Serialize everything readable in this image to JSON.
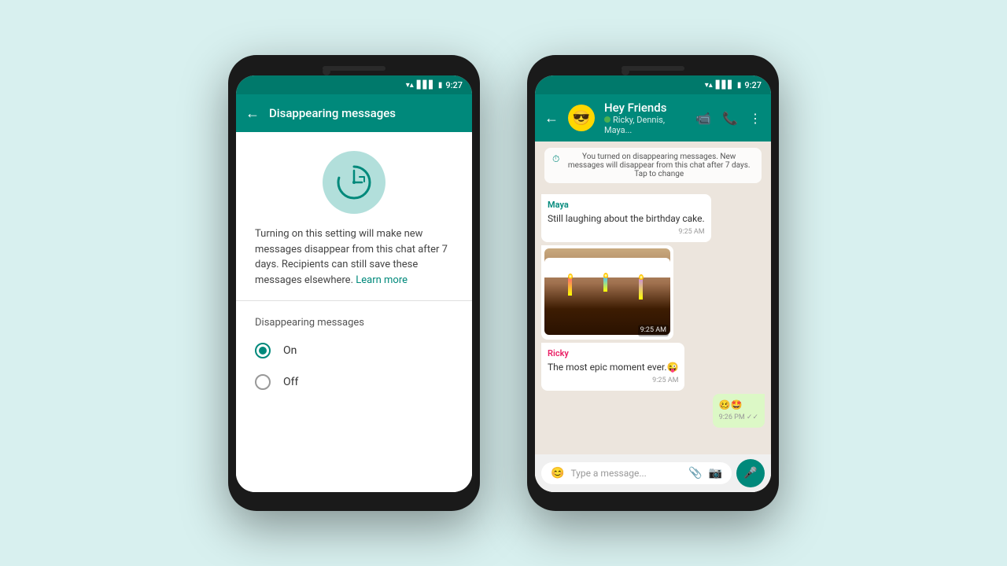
{
  "background_color": "#d8f0ef",
  "phone1": {
    "status_bar": {
      "time": "9:27",
      "bg_color": "#00796b"
    },
    "toolbar": {
      "title": "Disappearing messages",
      "back_arrow": "←"
    },
    "description": "Turning on this setting will make new messages disappear from this chat after 7 days. Recipients can still save these messages elsewhere.",
    "learn_more": "Learn more",
    "section_title": "Disappearing messages",
    "radio_on_label": "On",
    "radio_off_label": "Off",
    "on_selected": true
  },
  "phone2": {
    "status_bar": {
      "time": "9:27",
      "bg_color": "#00796b"
    },
    "toolbar": {
      "back_arrow": "←",
      "group_name": "Hey Friends",
      "members": "Ricky, Dennis, Maya...",
      "avatar_emoji": "😎"
    },
    "system_message": "You turned on disappearing messages. New messages will disappear from this chat after 7 days. Tap to change",
    "messages": [
      {
        "sender": "Maya",
        "sender_color": "maya",
        "text": "Still laughing about the birthday cake.",
        "time": "9:25 AM",
        "type": "incoming"
      },
      {
        "sender": "",
        "type": "image",
        "time": "9:25 AM"
      },
      {
        "sender": "Ricky",
        "sender_color": "ricky",
        "text": "The most epic moment ever.😜",
        "time": "9:25 AM",
        "type": "incoming"
      },
      {
        "sender": "",
        "text": "🥴🤩",
        "time": "9:26 PM ✓✓",
        "type": "outgoing"
      }
    ],
    "input_placeholder": "Type a message...",
    "input_emoji": "😊",
    "input_attach": "📎",
    "input_camera": "📷",
    "mic_icon": "🎤"
  }
}
